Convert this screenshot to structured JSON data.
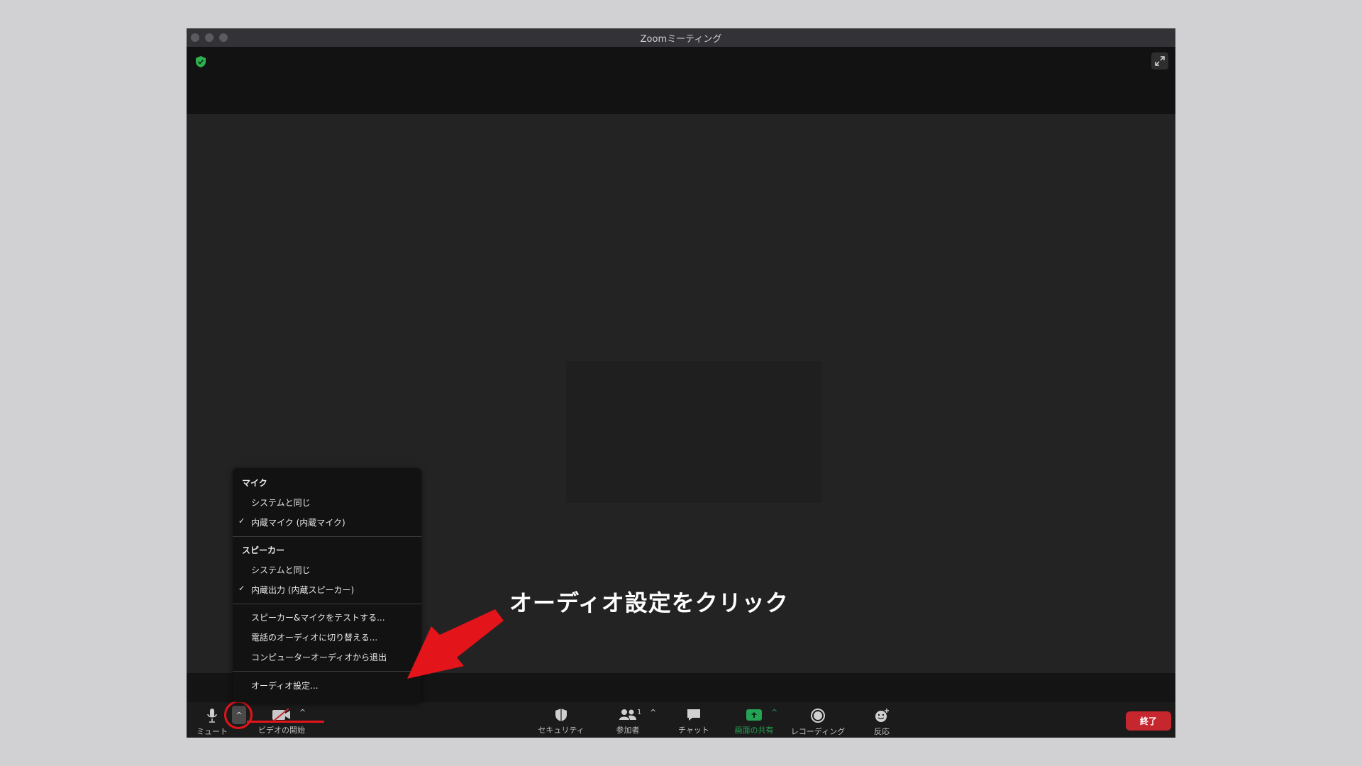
{
  "window": {
    "title": "Zoomミーティング"
  },
  "audio_menu": {
    "mic_header": "マイク",
    "mic_options": [
      {
        "label": "システムと同じ",
        "checked": false
      },
      {
        "label": "内蔵マイク (内蔵マイク)",
        "checked": true
      }
    ],
    "speaker_header": "スピーカー",
    "speaker_options": [
      {
        "label": "システムと同じ",
        "checked": false
      },
      {
        "label": "内蔵出力 (内蔵スピーカー)",
        "checked": true
      }
    ],
    "check_mark": "✓",
    "actions": [
      "スピーカー&マイクをテストする...",
      "電話のオーディオに切り替える...",
      "コンピューターオーディオから退出"
    ],
    "settings": "オーディオ設定..."
  },
  "toolbar": {
    "mute": "ミュート",
    "video": "ビデオの開始",
    "security": "セキュリティ",
    "participants": "参加者",
    "participants_count": "1",
    "chat": "チャット",
    "share": "画面の共有",
    "record": "レコーディング",
    "reactions": "反応",
    "end": "終了",
    "caret": "^"
  },
  "annotation": {
    "text": "オーディオ設定をクリック"
  },
  "colors": {
    "highlight_red": "#e3141a",
    "share_green": "#23a455",
    "end_red": "#c6262e",
    "shield_green": "#2fb150"
  }
}
